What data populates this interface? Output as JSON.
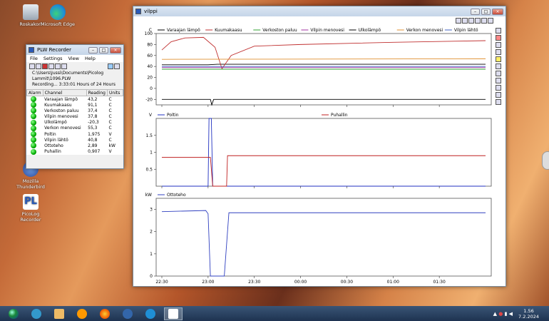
{
  "desktop": {
    "icons": [
      {
        "label": "Roskakori",
        "color": "#c9d2dc"
      },
      {
        "label": "Microsoft Edge",
        "color": "#1f8fd6"
      },
      {
        "label": "Mozilla Thunderbird",
        "color": "#5b7fc7"
      },
      {
        "label": "PicoLog Recorder",
        "color": "#2a5ab8"
      }
    ]
  },
  "recorder": {
    "title": "PLW Recorder",
    "menu": [
      "File",
      "Settings",
      "View",
      "Help"
    ],
    "path_line1": "C:\\Users\\Jussi\\Documents\\Picolog",
    "path_line2": "Lammit\\1096.PLW",
    "status": "Recording... 3:33:01 Hours of 24 Hours",
    "headers": [
      "Alarm",
      "Channel",
      "Reading",
      "Units"
    ],
    "rows": [
      {
        "channel": "Varaajan lämpö",
        "reading": "43,2",
        "unit": "C"
      },
      {
        "channel": "Kuumakaasu",
        "reading": "91,1",
        "unit": "C"
      },
      {
        "channel": "Verkoston paluu",
        "reading": "37,4",
        "unit": "C"
      },
      {
        "channel": "Vilpin menovesi",
        "reading": "37,8",
        "unit": "C"
      },
      {
        "channel": "Ulkolämpö",
        "reading": "-20,3",
        "unit": "C"
      },
      {
        "channel": "Verkon menovesi",
        "reading": "55,3",
        "unit": "C"
      },
      {
        "channel": "Poltin",
        "reading": "1,975",
        "unit": "V"
      },
      {
        "channel": "Vilpin lähtö",
        "reading": "40,8",
        "unit": "C"
      },
      {
        "channel": "Ottoteho",
        "reading": "2,89",
        "unit": "kW"
      },
      {
        "channel": "Puhallin",
        "reading": "0,907",
        "unit": "V"
      }
    ]
  },
  "graph": {
    "title": "vilppi",
    "x_ticks": [
      "22:30",
      "23:00",
      "23:30",
      "00:00",
      "00:30",
      "01:00",
      "01:30"
    ]
  },
  "chart_data": [
    {
      "type": "line",
      "ylabel": "C",
      "ylim": [
        -30,
        100
      ],
      "yticks": [
        -20,
        0,
        20,
        40,
        60,
        80,
        100
      ],
      "x_ticks": [
        "22:30",
        "23:00",
        "23:30",
        "00:00",
        "00:30",
        "01:00",
        "01:30"
      ],
      "series": [
        {
          "name": "Varaajan lämpö",
          "color": "#000000",
          "x": [
            0,
            1.0,
            1.2,
            1.5,
            7
          ],
          "y": [
            43,
            43,
            44,
            44,
            44
          ]
        },
        {
          "name": "Kuumakaasu",
          "color": "#c03030",
          "x": [
            0,
            0.2,
            0.5,
            0.9,
            1.15,
            1.3,
            1.5,
            2,
            3,
            5,
            7
          ],
          "y": [
            70,
            85,
            92,
            93,
            75,
            36,
            60,
            77,
            80,
            84,
            87
          ]
        },
        {
          "name": "Verkoston paluu",
          "color": "#30a030",
          "x": [
            0,
            7
          ],
          "y": [
            35,
            35
          ]
        },
        {
          "name": "Vilpin menovesi",
          "color": "#a030a0",
          "x": [
            0,
            7
          ],
          "y": [
            38,
            38
          ]
        },
        {
          "name": "Ulkolämpö",
          "color": "#000000",
          "x": [
            0,
            1.05,
            1.08,
            1.12,
            7
          ],
          "y": [
            -20,
            -20,
            -30,
            -20,
            -20
          ]
        },
        {
          "name": "Verkon menovesi",
          "color": "#e09030",
          "x": [
            0,
            7
          ],
          "y": [
            53,
            54
          ]
        },
        {
          "name": "Vilpin lähtö",
          "color": "#4060c0",
          "x": [
            0,
            7
          ],
          "y": [
            40,
            40
          ]
        }
      ]
    },
    {
      "type": "line",
      "ylabel": "V",
      "ylim": [
        0,
        2
      ],
      "yticks": [
        0.5,
        1,
        1.5
      ],
      "x_ticks": [
        "22:30",
        "23:00",
        "23:30",
        "00:00",
        "00:30",
        "01:00",
        "01:30"
      ],
      "series": [
        {
          "name": "Poltin",
          "color": "#2030c0",
          "x": [
            0,
            1.0,
            1.02,
            1.07,
            1.1,
            7
          ],
          "y": [
            0,
            0,
            2.0,
            2.0,
            0,
            0
          ]
        },
        {
          "name": "Puhallin",
          "color": "#c02020",
          "x": [
            0,
            1.05,
            1.1,
            1.4,
            1.42,
            7
          ],
          "y": [
            0.85,
            0.85,
            0,
            0,
            0.9,
            0.9
          ]
        }
      ]
    },
    {
      "type": "line",
      "ylabel": "kW",
      "ylim": [
        0,
        3.5
      ],
      "yticks": [
        0,
        1,
        2,
        3
      ],
      "x_ticks": [
        "22:30",
        "23:00",
        "23:30",
        "00:00",
        "00:30",
        "01:00",
        "01:30"
      ],
      "series": [
        {
          "name": "Ottoteho",
          "color": "#3040c0",
          "x": [
            0,
            0.95,
            1.0,
            1.05,
            1.35,
            1.45,
            7
          ],
          "y": [
            2.9,
            2.95,
            2.8,
            0,
            0,
            2.85,
            2.85
          ]
        }
      ]
    }
  ],
  "taskbar": {
    "time": "1.56",
    "date": "7.2.2024"
  }
}
